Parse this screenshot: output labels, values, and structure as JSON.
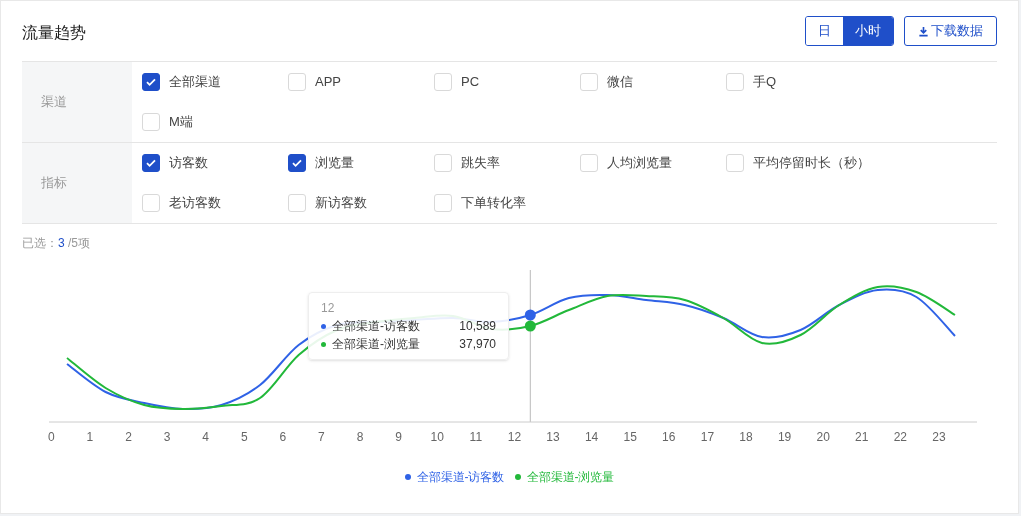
{
  "title": "流量趋势",
  "granularity": [
    {
      "label": "日",
      "selected": false
    },
    {
      "label": "小时",
      "selected": true
    }
  ],
  "download_button": "下载数据",
  "filters": [
    {
      "label": "渠道",
      "options": [
        {
          "label": "全部渠道",
          "checked": true
        },
        {
          "label": "APP",
          "checked": false
        },
        {
          "label": "PC",
          "checked": false
        },
        {
          "label": "微信",
          "checked": false
        },
        {
          "label": "手Q",
          "checked": false
        },
        {
          "label": "M端",
          "checked": false
        }
      ]
    },
    {
      "label": "指标",
      "options": [
        {
          "label": "访客数",
          "checked": true
        },
        {
          "label": "浏览量",
          "checked": true
        },
        {
          "label": "跳失率",
          "checked": false
        },
        {
          "label": "人均浏览量",
          "checked": false
        },
        {
          "label": "平均停留时长（秒）",
          "checked": false
        },
        {
          "label": "老访客数",
          "checked": false
        },
        {
          "label": "新访客数",
          "checked": false
        },
        {
          "label": "下单转化率",
          "checked": false
        }
      ]
    }
  ],
  "selection_summary": {
    "prefix": "已选：",
    "count": "3",
    "suffix": "/5项"
  },
  "chart": {
    "x_labels": [
      "0",
      "1",
      "2",
      "3",
      "4",
      "5",
      "6",
      "7",
      "8",
      "9",
      "10",
      "11",
      "12",
      "13",
      "14",
      "15",
      "16",
      "17",
      "18",
      "19",
      "20",
      "21",
      "22",
      "23"
    ],
    "tooltip": {
      "title": "12",
      "rows": [
        {
          "name": "全部渠道-访客数",
          "value": "10,589",
          "color": "#2f62e6"
        },
        {
          "name": "全部渠道-浏览量",
          "value": "37,970",
          "color": "#22b83a"
        }
      ]
    },
    "legend": [
      {
        "name": "全部渠道-访客数",
        "color": "#2f62e6"
      },
      {
        "name": "全部渠道-浏览量",
        "color": "#22b83a"
      }
    ]
  }
}
